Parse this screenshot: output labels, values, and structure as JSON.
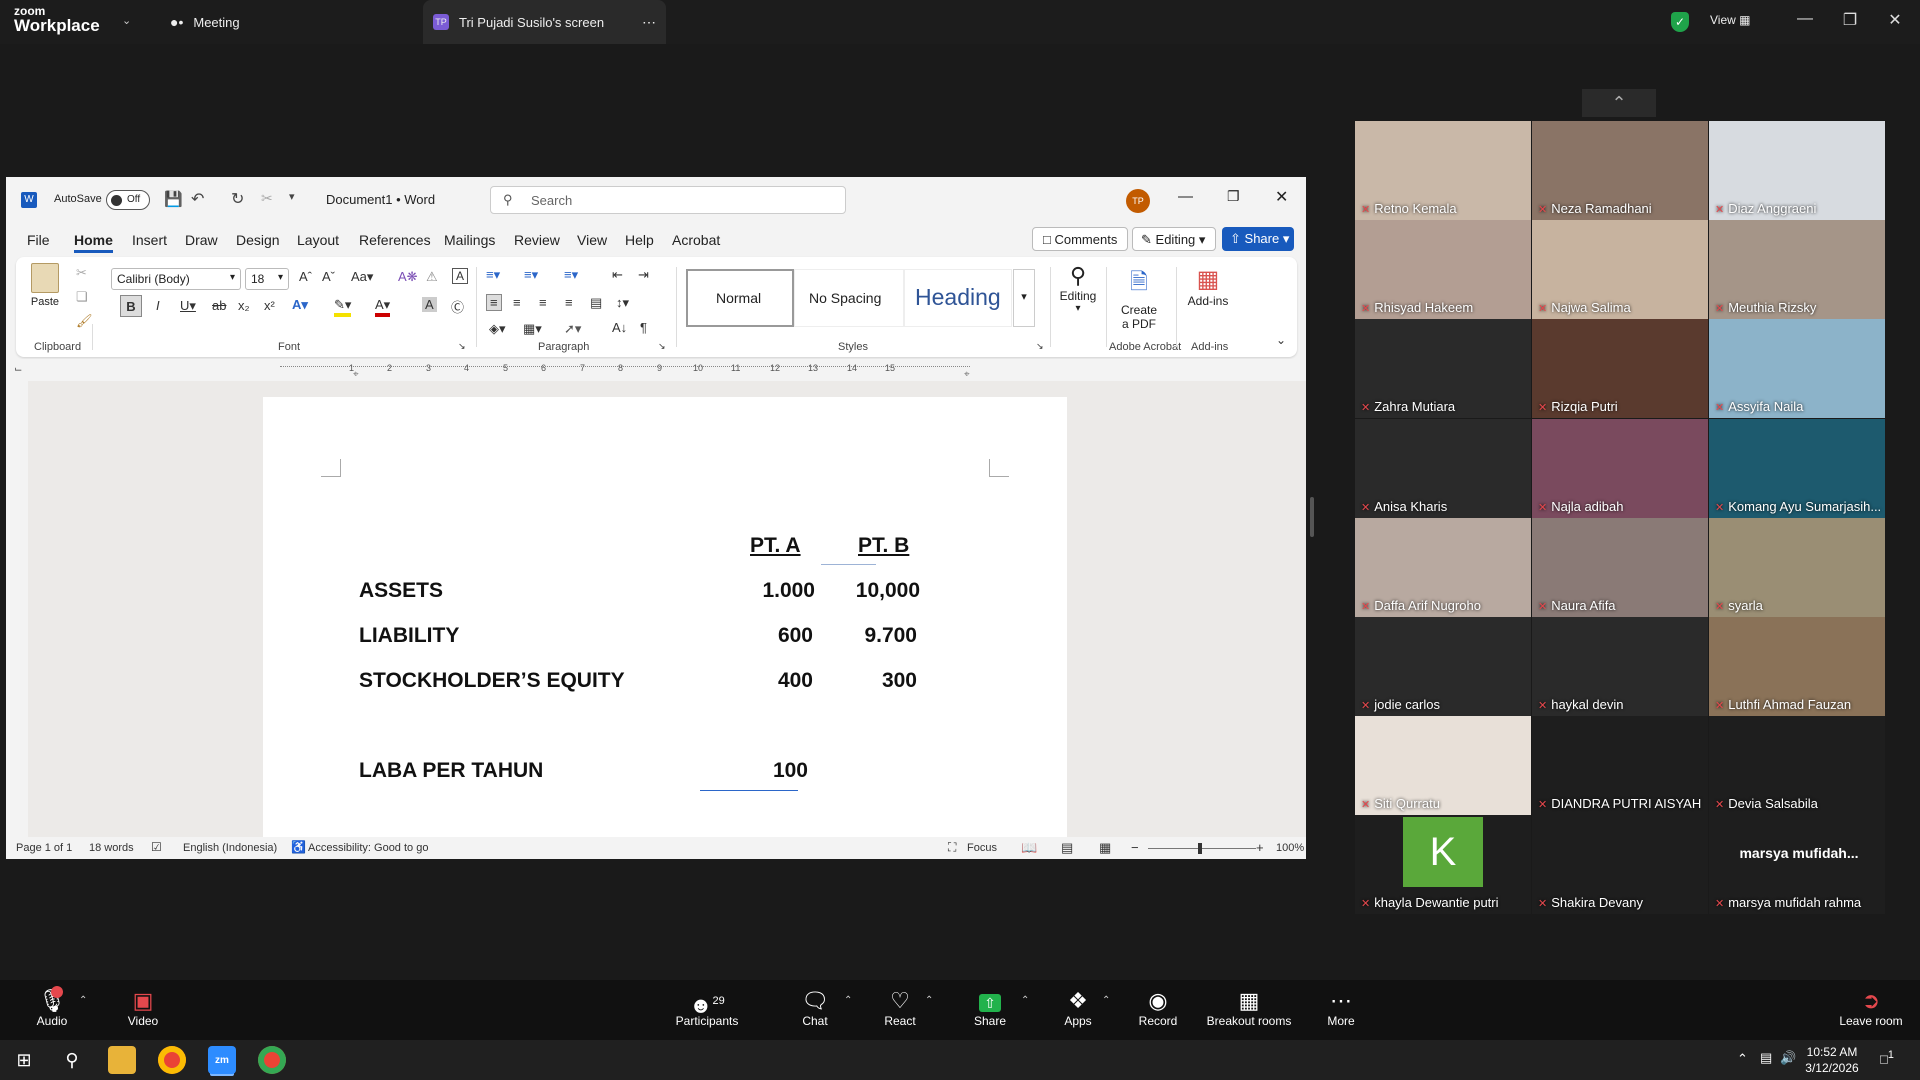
{
  "zoom_top": {
    "logo_line1": "zoom",
    "logo_line2": "Workplace",
    "meeting_tab": "Meeting",
    "share_tab_initials": "TP",
    "share_tab_label": "Tri Pujadi Susilo's screen",
    "view_label": "View"
  },
  "word": {
    "autosave_label": "AutoSave",
    "autosave_state": "Off",
    "doc_title": "Document1 • Word",
    "search_placeholder": "Search",
    "user_initials": "TP",
    "menu": [
      "File",
      "Home",
      "Insert",
      "Draw",
      "Design",
      "Layout",
      "References",
      "Mailings",
      "Review",
      "View",
      "Help",
      "Acrobat"
    ],
    "comments_label": "Comments",
    "editing_label": "Editing",
    "share_label": "Share",
    "ribbon": {
      "paste_label": "Paste",
      "clipboard_label": "Clipboard",
      "font_name": "Calibri (Body)",
      "font_size": "18",
      "font_label": "Font",
      "paragraph_label": "Paragraph",
      "styles_label": "Styles",
      "style_normal": "Normal",
      "style_nospacing": "No Spacing",
      "style_heading": "Heading",
      "editing_btn": "Editing",
      "create_pdf_line1": "Create",
      "create_pdf_line2": "a PDF",
      "adobe_label": "Adobe Acrobat",
      "addins_btn": "Add-ins",
      "addins_label": "Add-ins"
    },
    "ruler_numbers": [
      "1",
      "2",
      "3",
      "4",
      "5",
      "6",
      "7",
      "8",
      "9",
      "10",
      "11",
      "12",
      "13",
      "14",
      "15"
    ],
    "document": {
      "col_a": "PT. A",
      "col_b": "PT. B",
      "rows": [
        {
          "label": "ASSETS",
          "a": "1.000",
          "b": "10,000"
        },
        {
          "label": "LIABILITY",
          "a": "600",
          "b": "9.700"
        },
        {
          "label": "STOCKHOLDER’S EQUITY",
          "a": "400",
          "b": "300"
        }
      ],
      "laba_label": "LABA PER TAHUN",
      "laba_value": "100"
    },
    "status": {
      "page": "Page 1 of 1",
      "words": "18 words",
      "language": "English (Indonesia)",
      "accessibility": "Accessibility: Good to go",
      "focus": "Focus",
      "zoom": "100%"
    }
  },
  "participants": [
    {
      "name": "Retno Kemala",
      "bg": "#c9b8a8"
    },
    {
      "name": "Neza Ramadhani",
      "bg": "#8a7466"
    },
    {
      "name": "Diaz Anggraeni",
      "bg": "#d7dbe0"
    },
    {
      "name": "Rhisyad Hakeem",
      "bg": "#b39e93"
    },
    {
      "name": "Najwa Salima",
      "bg": "#c7b39f"
    },
    {
      "name": "Meuthia Rizsky",
      "bg": "#a59588"
    },
    {
      "name": "Zahra Mutiara",
      "bg": "#2a2a2a"
    },
    {
      "name": "Rizqia Putri",
      "bg": "#5a3a2e"
    },
    {
      "name": "Assyifa Naila",
      "bg": "#8cb3c9"
    },
    {
      "name": "Anisa Kharis",
      "bg": "#2a2a2a"
    },
    {
      "name": "Najla adibah",
      "bg": "#7a4a5e"
    },
    {
      "name": "Komang Ayu Sumarjasih...",
      "bg": "#1d5a6e"
    },
    {
      "name": "Daffa Arif Nugroho",
      "bg": "#b8a9a0"
    },
    {
      "name": "Naura Afifa",
      "bg": "#8a7a76"
    },
    {
      "name": "syarla",
      "bg": "#9a8e74"
    },
    {
      "name": "jodie carlos",
      "bg": "#2a2a2a"
    },
    {
      "name": "haykal devin",
      "bg": "#2a2a2a"
    },
    {
      "name": "Luthfi Ahmad Fauzan",
      "bg": "#8a7258"
    },
    {
      "name": "Siti Qurratu",
      "bg": "#e8e0d8"
    },
    {
      "name": "DIANDRA PUTRI AISYAH",
      "bg": "#1e1e1e"
    },
    {
      "name": "Devia Salsabila",
      "bg": "#1e1e1e"
    },
    {
      "name": "khayla Dewantie putri",
      "bg": "#1e1e1e"
    },
    {
      "name": "Shakira Devany",
      "bg": "#1e1e1e"
    },
    {
      "name": "marsya mufidah rahma",
      "bg": "#1e1e1e"
    }
  ],
  "marsya_title": "marsya  mufidah...",
  "khayla_initial": "K",
  "toolbar": {
    "audio": "Audio",
    "video": "Video",
    "participants": "Participants",
    "participants_count": "29",
    "chat": "Chat",
    "react": "React",
    "share": "Share",
    "apps": "Apps",
    "record": "Record",
    "breakout": "Breakout rooms",
    "more": "More",
    "leave": "Leave room"
  },
  "taskbar": {
    "time": "10:52 AM",
    "date": "3/12/2026",
    "notif_count": "1"
  }
}
